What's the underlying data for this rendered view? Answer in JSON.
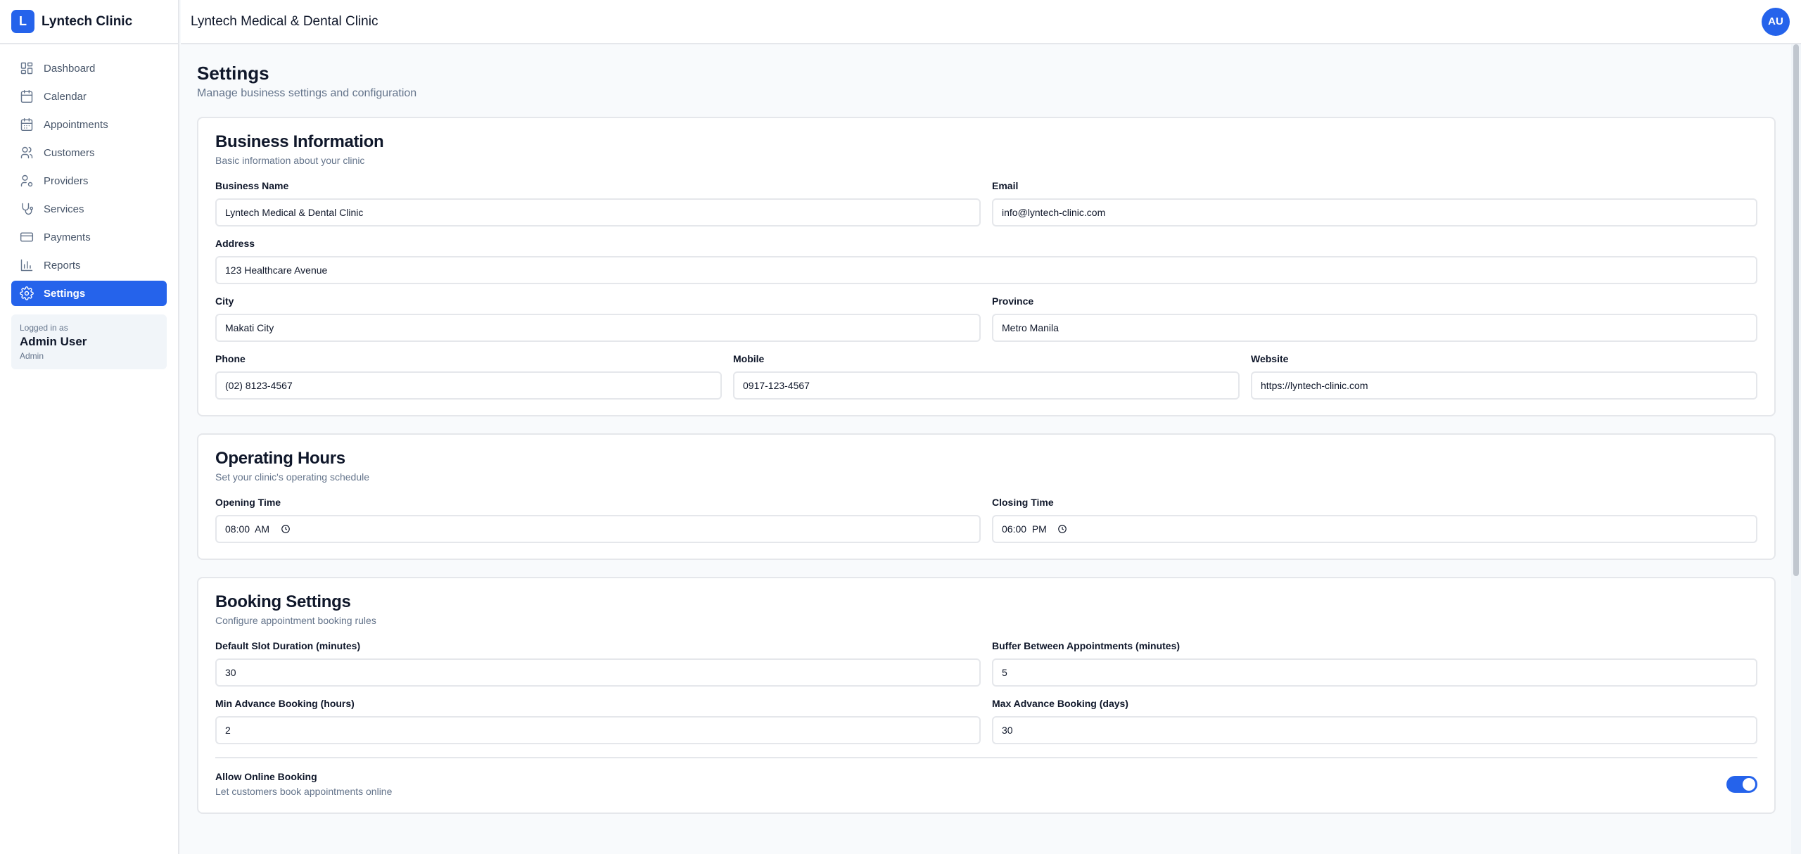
{
  "brand": {
    "logo_letter": "L",
    "name": "Lyntech Clinic"
  },
  "sidebar": {
    "items": [
      {
        "label": "Dashboard",
        "icon": "dashboard-icon",
        "active": false
      },
      {
        "label": "Calendar",
        "icon": "calendar-icon",
        "active": false
      },
      {
        "label": "Appointments",
        "icon": "calendar-check-icon",
        "active": false
      },
      {
        "label": "Customers",
        "icon": "users-icon",
        "active": false
      },
      {
        "label": "Providers",
        "icon": "user-cog-icon",
        "active": false
      },
      {
        "label": "Services",
        "icon": "stethoscope-icon",
        "active": false
      },
      {
        "label": "Payments",
        "icon": "credit-card-icon",
        "active": false
      },
      {
        "label": "Reports",
        "icon": "bar-chart-icon",
        "active": false
      },
      {
        "label": "Settings",
        "icon": "gear-icon",
        "active": true
      }
    ],
    "user": {
      "caption": "Logged in as",
      "name": "Admin User",
      "role": "Admin"
    }
  },
  "header": {
    "title": "Lyntech Medical & Dental Clinic",
    "avatar_initials": "AU"
  },
  "page": {
    "title": "Settings",
    "subtitle": "Manage business settings and configuration"
  },
  "business": {
    "title": "Business Information",
    "subtitle": "Basic information about your clinic",
    "business_name": {
      "label": "Business Name",
      "value": "Lyntech Medical & Dental Clinic"
    },
    "email": {
      "label": "Email",
      "value": "info@lyntech-clinic.com"
    },
    "address": {
      "label": "Address",
      "value": "123 Healthcare Avenue"
    },
    "city": {
      "label": "City",
      "value": "Makati City"
    },
    "province": {
      "label": "Province",
      "value": "Metro Manila"
    },
    "phone": {
      "label": "Phone",
      "value": "(02) 8123-4567"
    },
    "mobile": {
      "label": "Mobile",
      "value": "0917-123-4567"
    },
    "website": {
      "label": "Website",
      "value": "https://lyntech-clinic.com"
    }
  },
  "hours": {
    "title": "Operating Hours",
    "subtitle": "Set your clinic's operating schedule",
    "opening": {
      "label": "Opening Time",
      "value": "08:00  AM"
    },
    "closing": {
      "label": "Closing Time",
      "value": "06:00  PM"
    }
  },
  "booking": {
    "title": "Booking Settings",
    "subtitle": "Configure appointment booking rules",
    "slot_duration": {
      "label": "Default Slot Duration (minutes)",
      "value": "30"
    },
    "buffer": {
      "label": "Buffer Between Appointments (minutes)",
      "value": "5"
    },
    "min_advance": {
      "label": "Min Advance Booking (hours)",
      "value": "2"
    },
    "max_advance": {
      "label": "Max Advance Booking (days)",
      "value": "30"
    },
    "online_booking": {
      "title": "Allow Online Booking",
      "subtitle": "Let customers book appointments online",
      "enabled": true
    }
  },
  "colors": {
    "accent": "#2563eb",
    "muted_text": "#64748b",
    "border": "#e5e7eb",
    "background": "#f8fafc"
  }
}
